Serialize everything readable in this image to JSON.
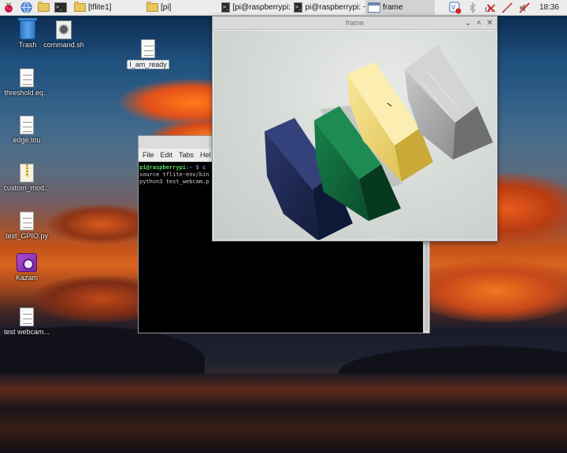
{
  "taskbar": {
    "tasks": [
      {
        "label": "[tflite1]",
        "icon": "folder-icon"
      },
      {
        "label": "[pi]",
        "icon": "folder-icon"
      },
      {
        "label": "[pi@raspberrypi:...",
        "icon": "terminal-icon"
      },
      {
        "label": "pi@raspberrypi: ~",
        "icon": "terminal-icon"
      },
      {
        "label": "frame",
        "icon": "window-icon"
      }
    ],
    "clock": "18:36"
  },
  "desktop_icons": [
    {
      "label": "Trash",
      "icon": "trash-icon"
    },
    {
      "label": "command.sh",
      "icon": "script-icon"
    },
    {
      "label": "I_am_ready",
      "icon": "document-icon"
    },
    {
      "label": "threshold.eq...",
      "icon": "document-icon"
    },
    {
      "label": "edge.tou",
      "icon": "document-icon"
    },
    {
      "label": "custom_mod...",
      "icon": "archive-icon"
    },
    {
      "label": "test_GPIO.py",
      "icon": "document-icon"
    },
    {
      "label": "Kazam",
      "icon": "kazam-icon"
    },
    {
      "label": "test webcam...",
      "icon": "document-icon"
    }
  ],
  "terminal": {
    "menu": [
      "File",
      "Edit",
      "Tabs",
      "Hel"
    ],
    "prompt_user": "pi@raspberrypi",
    "prompt_path": ":~ $",
    "prompt_cmd": " c",
    "lines": [
      "source tflite-env/bin",
      "python3 test_webcam.p"
    ]
  },
  "frame_window": {
    "title": "frame",
    "controls": [
      "⌄",
      "˄",
      "✕"
    ]
  },
  "colors": {
    "block_blue": "#1d2852",
    "block_green": "#0f6a3c",
    "block_yellow": "#eed878",
    "block_gray": "#a9abab"
  }
}
